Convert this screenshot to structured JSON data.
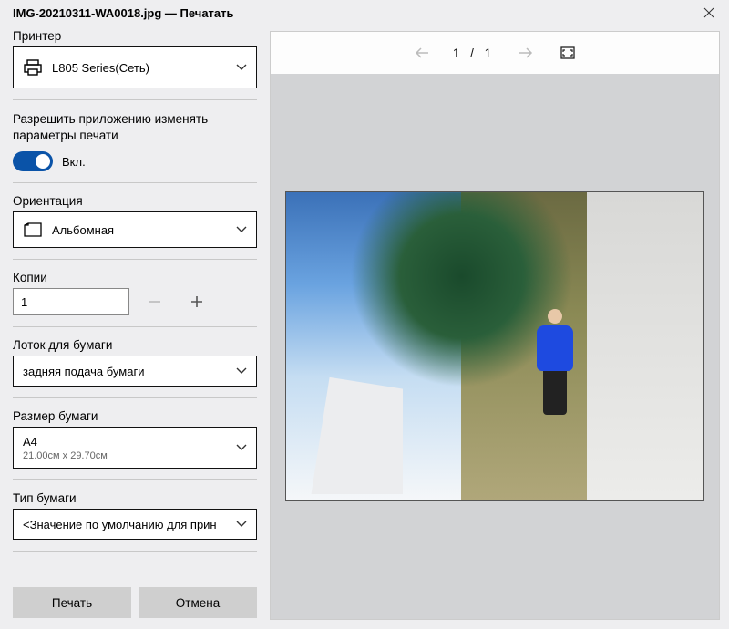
{
  "window": {
    "title": "IMG-20210311-WA0018.jpg — Печатать"
  },
  "printer": {
    "label": "Принтер",
    "value": "L805 Series(Сеть)"
  },
  "allowApp": {
    "label": "Разрешить приложению изменять параметры печати",
    "state": "Вкл."
  },
  "orientation": {
    "label": "Ориентация",
    "value": "Альбомная"
  },
  "copies": {
    "label": "Копии",
    "value": "1"
  },
  "tray": {
    "label": "Лоток для бумаги",
    "value": "задняя подача бумаги"
  },
  "paperSize": {
    "label": "Размер бумаги",
    "value": "A4",
    "dims": "21.00см x 29.70см"
  },
  "paperType": {
    "label": "Тип бумаги",
    "value": "<Значение по умолчанию для прин"
  },
  "footer": {
    "print": "Печать",
    "cancel": "Отмена"
  },
  "preview": {
    "page": "1 / 1"
  }
}
